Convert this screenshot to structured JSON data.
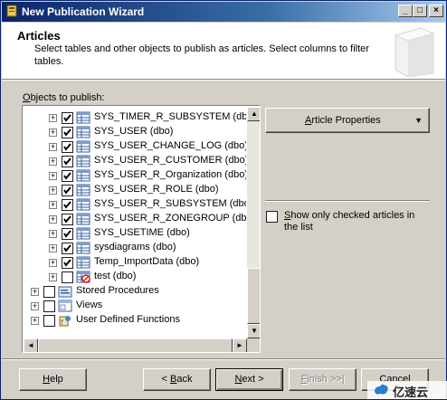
{
  "window": {
    "title": "New Publication Wizard",
    "minimize_glyph": "_",
    "maximize_glyph": "□",
    "close_glyph": "×"
  },
  "header": {
    "title": "Articles",
    "description": "Select tables and other objects to publish as articles. Select columns to filter tables."
  },
  "objects_label_accel": "O",
  "objects_label_rest": "bjects to publish:",
  "tree": {
    "items": [
      {
        "label": "SYS_TIMER_R_SUBSYSTEM (dbo)",
        "checked": true,
        "expander": "+",
        "icon": "table-icon"
      },
      {
        "label": "SYS_USER (dbo)",
        "checked": true,
        "expander": "+",
        "icon": "table-icon"
      },
      {
        "label": "SYS_USER_CHANGE_LOG (dbo)",
        "checked": true,
        "expander": "+",
        "icon": "table-icon"
      },
      {
        "label": "SYS_USER_R_CUSTOMER (dbo)",
        "checked": true,
        "expander": "+",
        "icon": "table-icon"
      },
      {
        "label": "SYS_USER_R_Organization (dbo)",
        "checked": true,
        "expander": "+",
        "icon": "table-icon"
      },
      {
        "label": "SYS_USER_R_ROLE (dbo)",
        "checked": true,
        "expander": "+",
        "icon": "table-icon"
      },
      {
        "label": "SYS_USER_R_SUBSYSTEM (dbo)",
        "checked": true,
        "expander": "+",
        "icon": "table-icon"
      },
      {
        "label": "SYS_USER_R_ZONEGROUP (dbo)",
        "checked": true,
        "expander": "+",
        "icon": "table-icon"
      },
      {
        "label": "SYS_USETIME (dbo)",
        "checked": true,
        "expander": "+",
        "icon": "table-icon"
      },
      {
        "label": "sysdiagrams (dbo)",
        "checked": true,
        "expander": "+",
        "icon": "table-icon"
      },
      {
        "label": "Temp_ImportData (dbo)",
        "checked": true,
        "expander": "+",
        "icon": "table-icon"
      },
      {
        "label": "test (dbo)",
        "checked": false,
        "expander": "+",
        "icon": "table-no-key-icon"
      }
    ],
    "groups": [
      {
        "label": "Stored Procedures",
        "checked": false,
        "expander": "+",
        "icon": "stored-procedure-icon"
      },
      {
        "label": "Views",
        "checked": false,
        "expander": "+",
        "icon": "view-icon"
      },
      {
        "label": "User Defined Functions",
        "checked": false,
        "expander": "+",
        "icon": "function-icon"
      }
    ]
  },
  "scroll": {
    "up": "▲",
    "down": "▼",
    "left": "◄",
    "right": "►"
  },
  "article_properties": {
    "label": "Article Properties",
    "arrow": "▼"
  },
  "show_checked": {
    "label": "Show only checked articles in the list",
    "checked": false
  },
  "buttons": {
    "help": "Help",
    "back": "< Back",
    "next": "Next >",
    "finish": "Finish >>|",
    "cancel": "Cancel"
  },
  "watermark": {
    "text": "亿速云"
  },
  "colors": {
    "titlebar_start": "#0a246a",
    "titlebar_end": "#a6caf0",
    "face": "#d4d0c8",
    "header_bg": "#ffffff"
  }
}
